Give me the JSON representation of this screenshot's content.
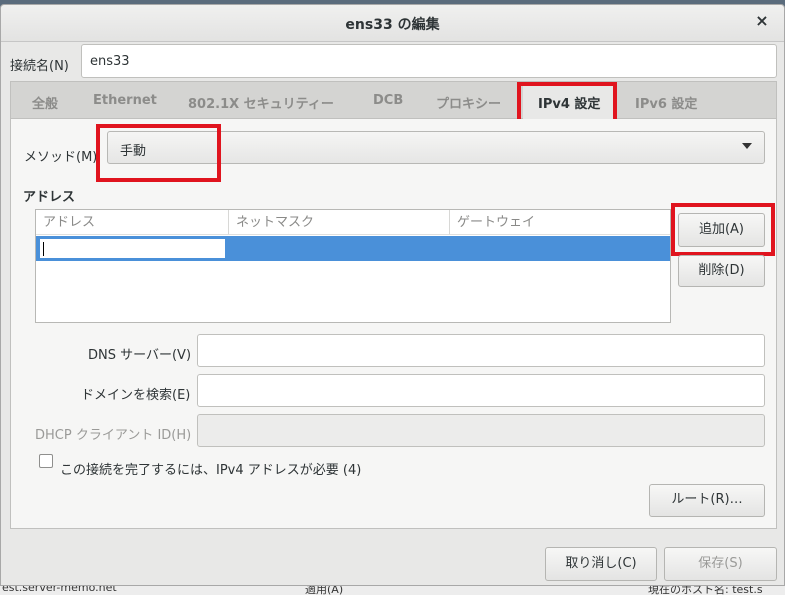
{
  "background": {
    "top_left_text": "",
    "bottom_left_text": "est.server-memo.net",
    "bottom_center_text": "適用(A)",
    "bottom_right_text": "現在のホスト名:   test.s"
  },
  "window": {
    "title": "ens33 の編集",
    "close_icon": "×"
  },
  "connection_name": {
    "label": "接続名(N)",
    "value": "ens33"
  },
  "tabs": [
    {
      "label": "全般",
      "active": false
    },
    {
      "label": "Ethernet",
      "active": false
    },
    {
      "label": "802.1X セキュリティー",
      "active": false
    },
    {
      "label": "DCB",
      "active": false
    },
    {
      "label": "プロキシー",
      "active": false
    },
    {
      "label": "IPv4 設定",
      "active": true
    },
    {
      "label": "IPv6 設定",
      "active": false
    }
  ],
  "method": {
    "label": "メソッド(M)",
    "value": "手動"
  },
  "address": {
    "section_title": "アドレス",
    "columns": [
      "アドレス",
      "ネットマスク",
      "ゲートウェイ"
    ],
    "add_button": "追加(A)",
    "delete_button": "削除(D)"
  },
  "dns": {
    "label": "DNS サーバー(V)",
    "value": ""
  },
  "search_domain": {
    "label": "ドメインを検索(E)",
    "value": ""
  },
  "dhcp_client_id": {
    "label": "DHCP クライアント ID(H)",
    "value": ""
  },
  "require_ipv4": {
    "label": "この接続を完了するには、IPv4 アドレスが必要 (4)",
    "checked": false
  },
  "routes_button": "ルート(R)…",
  "cancel_button": "取り消し(C)",
  "save_button": "保存(S)",
  "colors": {
    "highlight": "#e0141e",
    "selection": "#4a90d9"
  }
}
